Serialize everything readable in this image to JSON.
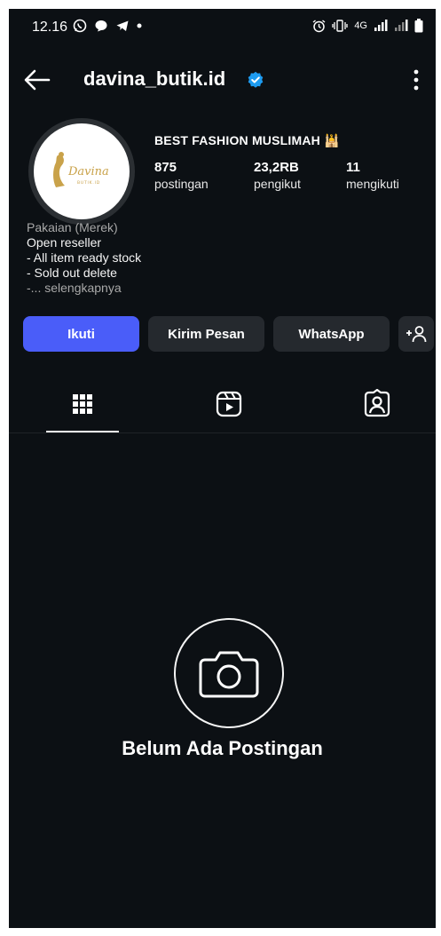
{
  "status_bar": {
    "time": "12.16",
    "network": "4G"
  },
  "header": {
    "username": "davina_butik.id"
  },
  "profile": {
    "display_name": "BEST FASHION MUSLIMAH 🕌",
    "stats": [
      {
        "value": "875",
        "label": "postingan"
      },
      {
        "value": "23,2RB",
        "label": "pengikut"
      },
      {
        "value": "11",
        "label": "mengikuti"
      }
    ],
    "category": "Pakaian (Merek)",
    "bio_lines": [
      "Open reseller",
      "- All item ready stock",
      "- Sold out delete"
    ],
    "bio_more": "-... selengkapnya",
    "logo_text": "Davina",
    "logo_subtext": "BUTIK.ID"
  },
  "buttons": {
    "follow": "Ikuti",
    "message": "Kirim Pesan",
    "whatsapp": "WhatsApp",
    "add_user": "+♀"
  },
  "empty_state": {
    "text": "Belum Ada Postingan"
  },
  "colors": {
    "background": "#0c1014",
    "accent": "#4a5df9",
    "button_secondary": "#25292e",
    "verified": "#1d9bf0"
  }
}
